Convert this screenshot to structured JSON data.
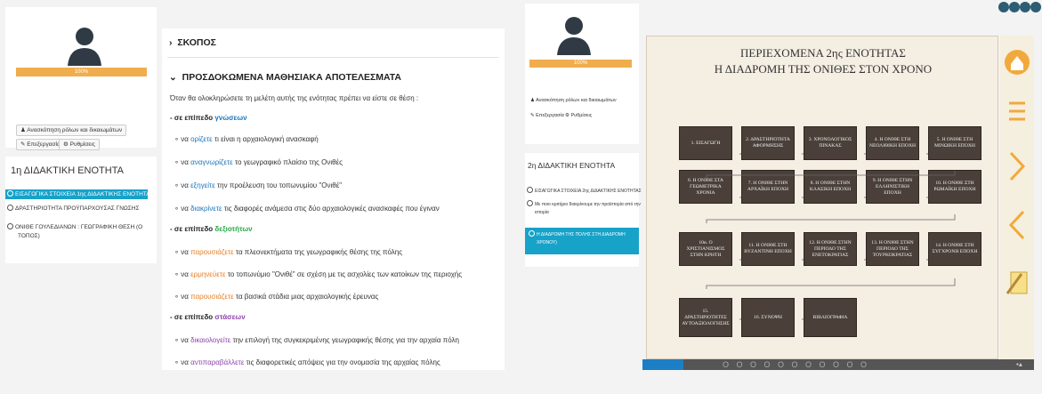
{
  "left": {
    "progress": "100%",
    "role_button": "Ανασκόπηση ρόλων και δικαιωμάτων",
    "edit_button": "Επεξεργασία",
    "settings_button": "Ρυθμίσεις",
    "unit_title": "1η ΔΙΔΑΚΤΙΚΗ ΕΝΟΤΗΤΑ",
    "items": [
      "ΕΙΣΑΓΩΓΙΚΑ ΣΤΟΙΧΕΙΑ 1ης ΔΙΔΑΚΤΙΚΗΣ ΕΝΟΤΗΤΑΣ",
      "ΔΡΑΣΤΗΡΙΟΤΗΤΑ ΠΡΟΫΠΑΡΧΟΥΣΑΣ ΓΝΩΣΗΣ",
      "ΟΝΙΘΕ ΓΟΥΛΕΔΙΑΝΩΝ : ΓΕΩΓΡΑΦΙΚΗ ΘΕΣΗ (Ο",
      "ΤΟΠΟΣ)"
    ]
  },
  "content": {
    "section1": "ΣΚΟΠΟΣ",
    "section2": "ΠΡΟΣΔΟΚΩΜΕΝΑ ΜΑΘΗΣΙΑΚΑ ΑΠΟΤΕΛΕΣΜΑΤΑ",
    "intro": "Όταν θα ολοκληρώσετε τη μελέτη αυτής της ενότητας πρέπει να είστε σε θέση :",
    "lvl_prefix": "- σε επίπεδο",
    "lvl1": "γνώσεων",
    "lvl2": "δεξιοτήτων",
    "lvl3": "στάσεων",
    "bullets": [
      {
        "pre": "να",
        "kw": "ορίζετε",
        "post": "τι είναι η αρχαιολογική ανασκαφή"
      },
      {
        "pre": "να",
        "kw": "αναγνωρίζετε",
        "post": "το γεωγραφικό πλαίσιο της Ονιθές"
      },
      {
        "pre": "να",
        "kw": "εξηγείτε",
        "post": "την προέλευση του τοπωνυμίου \"Ονιθέ\""
      },
      {
        "pre": "να",
        "kw": "διακρίνετε",
        "post": "τις διαφορές ανάμεσα στις δύο αρχαιολογικές ανασκαφές που έγιναν"
      },
      {
        "pre": "να",
        "kw": "παρουσιάζετε",
        "post": "τα πλεονεκτήματα της γεωγραφικής θέσης της πόλης"
      },
      {
        "pre": "να",
        "kw": "ερμηνεύετε",
        "post": "το τοπωνύμιο \"Ονιθέ\" σε σχέση με τις ασχολίες των κατοίκων της περιοχής"
      },
      {
        "pre": "να",
        "kw": "παρουσιάζετε",
        "post": "τα βασικά στάδια μιας αρχαιολογικής έρευνας"
      },
      {
        "pre": "να",
        "kw": "δικαιολογείτε",
        "post": "την επιλογή της συγκεκριμένης γεωγραφικής θέσης για την αρχαία πόλη"
      },
      {
        "pre": "να",
        "kw": "αντιπαραβάλλετε",
        "post": "τις διαφορετικές απόψεις για την ονομασία της αρχαίας πόλης"
      }
    ]
  },
  "mid": {
    "progress": "100%",
    "role_button": "Ανασκόπηση ρόλων και δικαιωμάτων",
    "edit_button": "Επεξεργασία",
    "settings_button": "Ρυθμίσεις",
    "unit_title": "2η ΔΙΔΑΚΤΙΚΗ ΕΝΟΤΗΤΑ",
    "items": [
      "ΕΙΣΑΓΩΓΙΚΑ ΣΤΟΙΧΕΙΑ 2ης ΔΙΔΑΚΤΙΚΗΣ ΕΝΟΤΗΤΑΣ",
      "Με ποιο κριτήριο διακρίνουμε την προϊστορία από την",
      "ιστορία",
      "Η ΔΙΑΔΡΟΜΗ ΤΗΣ ΠΟΛΗΣ ΣΤΗ ΔΙΑΔΡΟΜΗ",
      "ΧΡΟΝΟΥ)"
    ]
  },
  "slide": {
    "title1": "ΠΕΡΙΕΧΟΜΕΝΑ 2ης ΕΝΟΤΗΤΑΣ",
    "title2": "Η ΔΙΑΔΡΟΜΗ ΤΗΣ ΟΝΙΘΕΣ ΣΤΟΝ ΧΡΟΝΟ",
    "boxes": [
      "1. ΕΙΣΑΓΩΓΗ",
      "2. ΔΡΑΣΤΗΡΙΟΤΗΤΑ ΑΦΟΡΜΗΣΗΣ",
      "3. ΧΡΟΝΟΛΟΓΙΚΟΣ ΠΙΝΑΚΑΣ",
      "4. Η ΟΝΙΘΕ ΣΤΗ ΝΕΟΛΙΘΙΚΗ ΕΠΟΧΗ",
      "5. Η ΟΝΙΘΕ ΣΤΗ ΜΙΝΩΙΚΗ ΕΠΟΧΗ",
      "6. Η ΟΝΙΘΕ ΣΤΑ ΓΕΩΜΕΤΡΙΚΑ ΧΡΟΝΙΑ",
      "7. Η ΟΝΙΘΕ ΣΤΗΝ ΑΡΧΑΪΚΗ ΕΠΟΧΗ",
      "8. Η ΟΝΙΘΕ ΣΤΗΝ ΚΛΑΣΙΚΗ ΕΠΟΧΗ",
      "9. Η ΟΝΙΘΕ ΣΤΗΝ ΕΛΛΗΝΙΣΤΙΚΗ ΕΠΟΧΗ",
      "10. Η ΟΝΙΘΕ ΣΤΗ ΡΩΜΑΪΚΗ ΕΠΟΧΗ",
      "10α. Ο ΧΡΙΣΤΙΑΝΙΣΜΟΣ ΣΤΗΝ ΚΡΗΤΗ",
      "11. Η ΟΝΙΘΕ ΣΤΗ ΒΥΖΑΝΤΙΝΗ ΕΠΟΧΗ",
      "12. Η ΟΝΙΘΕ ΣΤΗΝ ΠΕΡΙΟΔΟ ΤΗΣ ΕΝΕΤΟΚΡΑΤΙΑΣ",
      "13. Η ΟΝΙΘΕ ΣΤΗΝ ΠΕΡΙΟΔΟ ΤΗΣ ΤΟΥΡΚΟΚΡΑΤΙΑΣ",
      "14. Η ΟΝΙΘΕ ΣΤΗ ΣΥΓΧΡΟΝΗ ΕΠΟΧΗ",
      "15. ΔΡΑΣΤΗΡΙΟΤΗΤΕΣ ΑΥΤΟΑΞΙΟΛΟΓΗΣΗΣ",
      "16. ΣΥΝΟΨΗ",
      "ΒΙΒΛΙΟΓΡΑΦΙΑ"
    ],
    "seek_dots": "O O O O O O O O   O O O"
  }
}
